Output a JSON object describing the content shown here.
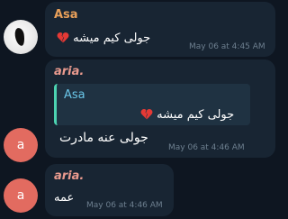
{
  "messages": [
    {
      "sender": "Asa",
      "text": "جولی کیم میشه",
      "emoji": "broken-heart",
      "time": "May 06 at 4:45 AM",
      "avatar": "photo"
    },
    {
      "sender": "aria.",
      "avatar_letter": "a",
      "reply": {
        "sender": "Asa",
        "text": "جولی کیم میشه",
        "emoji": "broken-heart"
      },
      "text": "جولی عنه مادرت",
      "time": "May 06 at 4:46 AM"
    },
    {
      "sender": "aria.",
      "avatar_letter": "a",
      "text": "عمه",
      "time": "May 06 at 4:46 AM"
    }
  ],
  "colors": {
    "background": "#0e1621",
    "bubble": "#182533",
    "asa_name": "#e8a05a",
    "aria_name": "#e99a8e",
    "quote_bar": "#4cd3b1",
    "timestamp": "#6d7f8f",
    "avatar_a": "#e26b60"
  }
}
